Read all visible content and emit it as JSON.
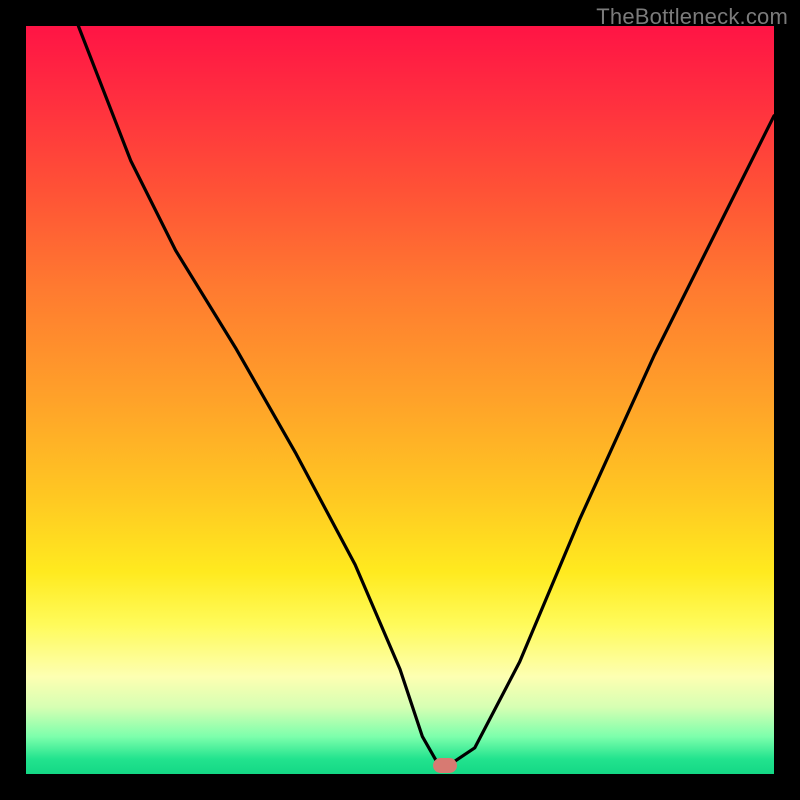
{
  "watermark": "TheBottleneck.com",
  "chart_data": {
    "type": "line",
    "title": "",
    "xlabel": "",
    "ylabel": "",
    "xlim": [
      0,
      100
    ],
    "ylim": [
      0,
      100
    ],
    "series": [
      {
        "name": "bottleneck-curve",
        "x": [
          7,
          14,
          20,
          28,
          36,
          44,
          50,
          53,
          55,
          57,
          60,
          66,
          74,
          84,
          94,
          100
        ],
        "values": [
          100,
          82,
          70,
          57,
          43,
          28,
          14,
          5,
          1.5,
          1.5,
          3.5,
          15,
          34,
          56,
          76,
          88
        ]
      }
    ],
    "marker": {
      "x": 56,
      "y": 1.2
    },
    "grid": false,
    "legend": false
  },
  "colors": {
    "curve": "#000000",
    "marker": "#d77a72",
    "frame": "#000000"
  }
}
